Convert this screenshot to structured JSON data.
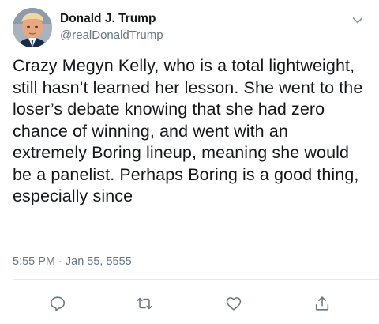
{
  "tweet": {
    "author": {
      "display_name": "Donald J. Trump",
      "handle": "@realDonaldTrump"
    },
    "text": "Crazy Megyn Kelly, who is a total lightweight, still hasn’t learned her lesson. She went to the loser’s debate knowing that she had zero chance of winning, and went with an extremely Boring lineup, meaning she would be a panelist. Perhaps Boring is a good thing, especially since",
    "timestamp": "5:55 PM · Jan 55, 5555"
  },
  "icons": {
    "menu": "chevron-down-icon",
    "reply": "reply-icon",
    "retweet": "retweet-icon",
    "like": "heart-icon",
    "share": "share-icon"
  },
  "colors": {
    "text": "#14171a",
    "secondary": "#657786",
    "divider": "#e1e8ed"
  }
}
